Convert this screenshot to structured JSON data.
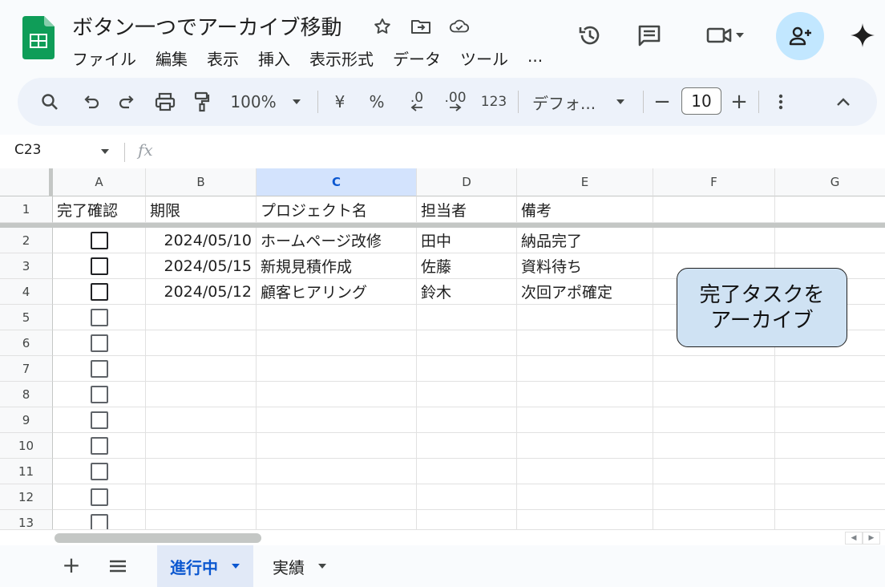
{
  "app": {
    "title": "ボタン一つでアーカイブ移動",
    "menu": [
      "ファイル",
      "編集",
      "表示",
      "挿入",
      "表示形式",
      "データ",
      "ツール",
      "..."
    ]
  },
  "toolbar": {
    "zoom": "100%",
    "currency": "¥",
    "percent": "%",
    "dec_decrease": ".0",
    "dec_increase": ".00",
    "number_format": "123",
    "font": "デフォ...",
    "font_size": "10",
    "minus": "−",
    "plus": "+"
  },
  "formula_bar": {
    "name_box": "C23",
    "fx": "fx"
  },
  "columns": [
    "A",
    "B",
    "C",
    "D",
    "E",
    "F",
    "G"
  ],
  "selected_column": "C",
  "row_numbers": [
    "1",
    "2",
    "3",
    "4",
    "5",
    "6",
    "7",
    "8",
    "9",
    "10",
    "11",
    "12",
    "13"
  ],
  "header_row": {
    "a": "完了確認",
    "b": "期限",
    "c": "プロジェクト名",
    "d": "担当者",
    "e": "備考"
  },
  "rows": [
    {
      "checked": false,
      "deadline": "2024/05/10",
      "project": "ホームページ改修",
      "owner": "田中",
      "note": "納品完了"
    },
    {
      "checked": false,
      "deadline": "2024/05/15",
      "project": "新規見積作成",
      "owner": "佐藤",
      "note": "資料待ち"
    },
    {
      "checked": false,
      "deadline": "2024/05/12",
      "project": "顧客ヒアリング",
      "owner": "鈴木",
      "note": "次回アポ確定"
    }
  ],
  "archive_button": {
    "line1": "完了タスクを",
    "line2": "アーカイブ"
  },
  "sheets": [
    {
      "name": "進行中",
      "active": true
    },
    {
      "name": "実績",
      "active": false
    }
  ],
  "colors": {
    "accent": "#0b57d0",
    "selected_header": "#d3e3fd",
    "drawing_fill": "#cfe2f3",
    "share_button": "#c2e7ff",
    "sheets_logo": "#0f9d58"
  }
}
